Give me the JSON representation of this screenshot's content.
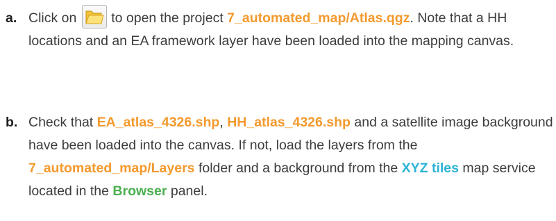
{
  "steps": [
    {
      "marker": "a.",
      "parts": {
        "t1": "Click on ",
        "t2": " to open the project ",
        "project": "7_automated_map/Atlas.qgz",
        "t3": ". Note that a HH locations and an EA framework layer have been loaded into the mapping canvas."
      },
      "icon": "open-folder-icon"
    },
    {
      "marker": "b.",
      "parts": {
        "t1": "Check that ",
        "ea": "EA_atlas_4326.shp",
        "t2": ", ",
        "hh": "HH_atlas_4326.shp",
        "t3": " and a satellite image background have been loaded into the canvas. If not, load the layers from the ",
        "layers": "7_automated_map/Layers",
        "t4": " folder and a background from the ",
        "xyz": "XYZ tiles",
        "t5": " map service located in the ",
        "browser": "Browser",
        "t6": " panel."
      }
    }
  ],
  "colors": {
    "text": "#3c3c3c",
    "orange": "#f39a2e",
    "cyan": "#2ab3d6",
    "green": "#4caf50"
  }
}
